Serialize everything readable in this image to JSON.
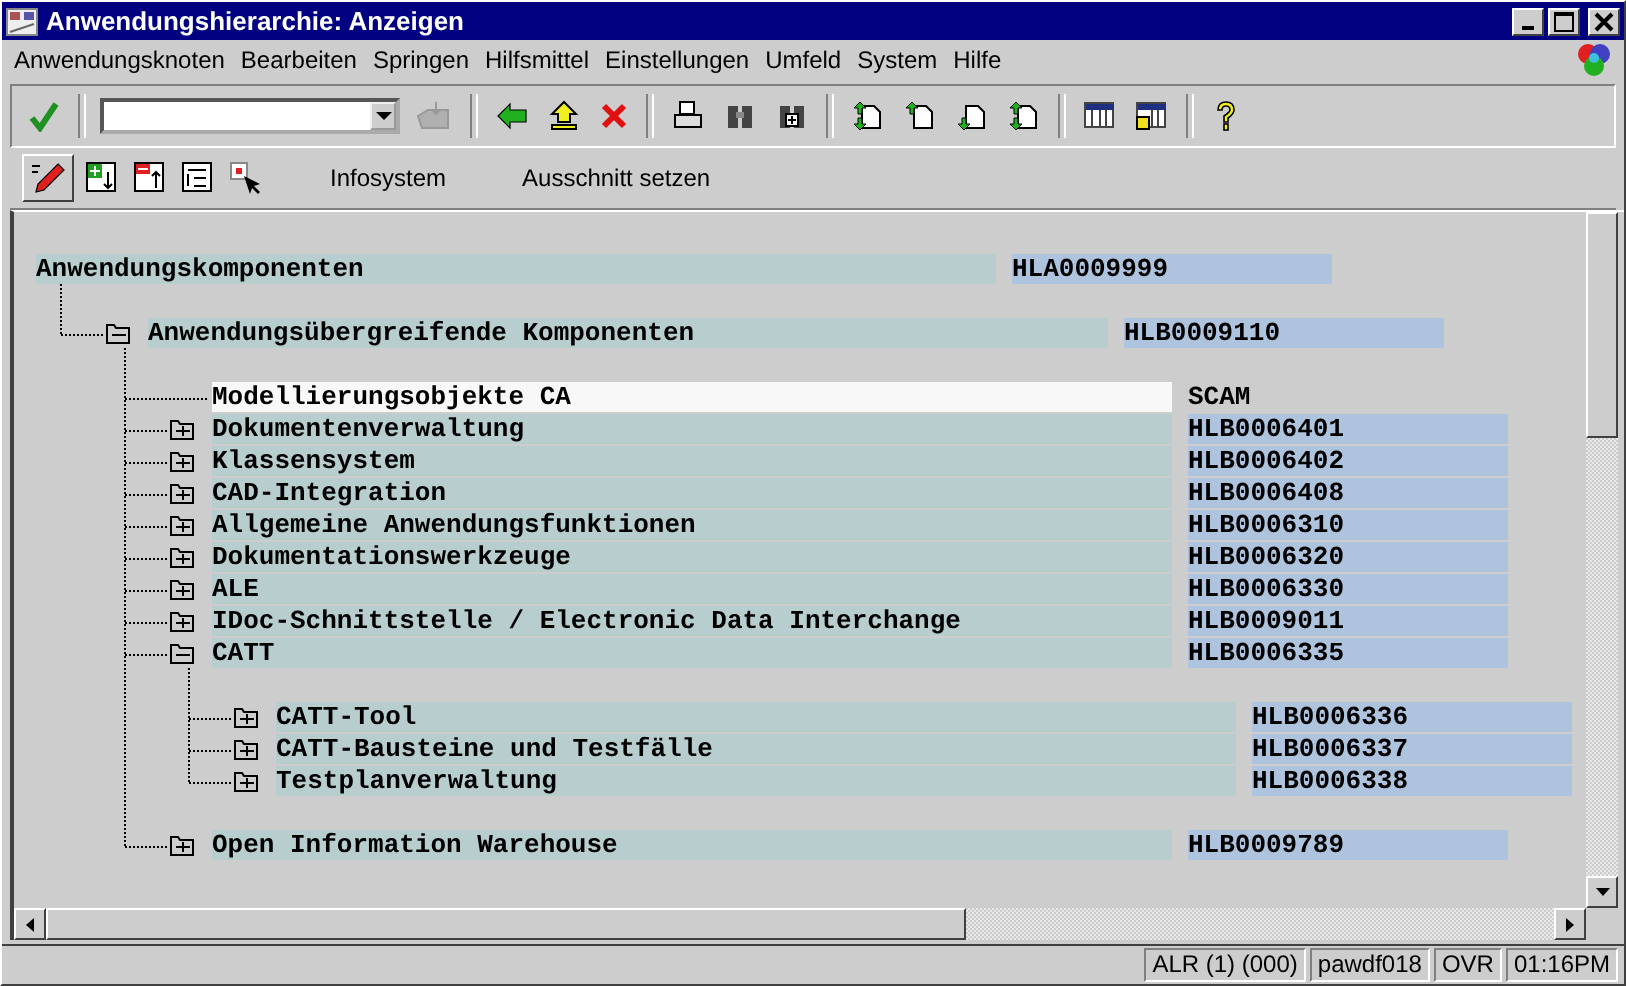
{
  "window": {
    "title": "Anwendungshierarchie: Anzeigen"
  },
  "menu": [
    "Anwendungsknoten",
    "Bearbeiten",
    "Springen",
    "Hilfsmittel",
    "Einstellungen",
    "Umfeld",
    "System",
    "Hilfe"
  ],
  "application_toolbar": [
    "Infosystem",
    "Ausschnitt setzen"
  ],
  "tree": [
    {
      "text": "Anwendungskomponenten",
      "code": "HLA0009999",
      "kind": "object",
      "selected": false,
      "children": [
        {
          "text": "Anwendungsübergreifende Komponenten",
          "code": "HLB0009110",
          "kind": "folder",
          "expanded": true,
          "selected": false,
          "children": [
            {
              "text": "Modellierungsobjekte CA",
              "code": "SCAM",
              "kind": "object",
              "selected": true
            },
            {
              "text": "Dokumentenverwaltung",
              "code": "HLB0006401",
              "kind": "folder",
              "expanded": false,
              "selected": false
            },
            {
              "text": "Klassensystem",
              "code": "HLB0006402",
              "kind": "folder",
              "expanded": false,
              "selected": false
            },
            {
              "text": "CAD-Integration",
              "code": "HLB0006408",
              "kind": "folder",
              "expanded": false,
              "selected": false
            },
            {
              "text": "Allgemeine Anwendungsfunktionen",
              "code": "HLB0006310",
              "kind": "folder",
              "expanded": false,
              "selected": false
            },
            {
              "text": "Dokumentationswerkzeuge",
              "code": "HLB0006320",
              "kind": "folder",
              "expanded": false,
              "selected": false
            },
            {
              "text": "ALE",
              "code": "HLB0006330",
              "kind": "folder",
              "expanded": false,
              "selected": false
            },
            {
              "text": "IDoc-Schnittstelle / Electronic Data Interchange",
              "code": "HLB0009011",
              "kind": "folder",
              "expanded": false,
              "selected": false
            },
            {
              "text": "CATT",
              "code": "HLB0006335",
              "kind": "folder",
              "expanded": true,
              "selected": false,
              "children": [
                {
                  "text": "CATT-Tool",
                  "code": "HLB0006336",
                  "kind": "folder",
                  "expanded": false,
                  "selected": false
                },
                {
                  "text": "CATT-Bausteine und Testfälle",
                  "code": "HLB0006337",
                  "kind": "folder",
                  "expanded": false,
                  "selected": false
                },
                {
                  "text": "Testplanverwaltung",
                  "code": "HLB0006338",
                  "kind": "folder",
                  "expanded": false,
                  "selected": false
                }
              ]
            },
            {
              "text": "Open Information Warehouse",
              "code": "HLB0009789",
              "kind": "folder",
              "expanded": false,
              "selected": false
            }
          ]
        }
      ]
    }
  ],
  "status_bar": [
    "ALR (1) (000)",
    "pawdf018",
    "OVR",
    "01:16PM"
  ]
}
